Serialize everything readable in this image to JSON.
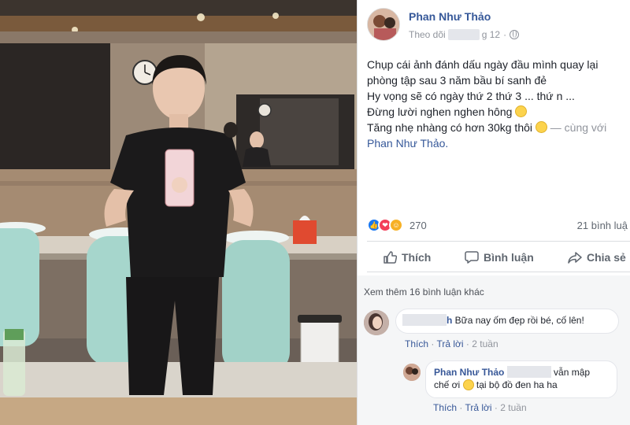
{
  "post": {
    "author": "Phan Như Thảo",
    "meta_follow": "Theo dõi",
    "meta_date_suffix": "g 12",
    "meta_dot": "·",
    "caption": {
      "line1": "Chụp cái ảnh đánh dấu ngày đầu mình quay lại",
      "line2": "phòng tập sau 3 năm bầu bí sanh đẻ",
      "line3": "Hy vọng sẽ có ngày thứ 2 thứ 3 ... thứ n ...",
      "line4": "Đừng lười nghen nghen hông",
      "line5": "Tăng nhẹ nhàng có hơn 30kg thôi",
      "with_text": "— cùng với",
      "tagged": "Phan Như Thảo."
    },
    "reaction_count": "270",
    "comment_count": "21 bình luậ",
    "actions": {
      "like": "Thích",
      "comment": "Bình luận",
      "share": "Chia sẻ"
    },
    "icons": [
      "like-reaction-icon",
      "love-reaction-icon",
      "haha-reaction-icon",
      "thumbs-up-icon",
      "comment-icon",
      "share-icon",
      "globe-icon"
    ]
  },
  "comments": {
    "see_more": "Xem thêm 16 bình luận khác",
    "items": [
      {
        "name_suffix": "h",
        "text": " Bữa nay ốm đẹp rồi bé, cố lên!",
        "like": "Thích",
        "reply": "Trả lời",
        "time": "2 tuần",
        "dot": "·"
      },
      {
        "name": "Phan Như Thảo",
        "text_a": "vẫn mập",
        "text_b": "chế ơi",
        "text_c": "tại bộ đồ đen ha ha",
        "like": "Thích",
        "reply": "Trả lời",
        "time": "2 tuần",
        "dot": "·"
      }
    ]
  },
  "colors": {
    "link": "#365899",
    "meta": "#90949c",
    "like_blue": "#1877f2",
    "love_red": "#f33e58",
    "haha_yellow": "#f7b125"
  }
}
